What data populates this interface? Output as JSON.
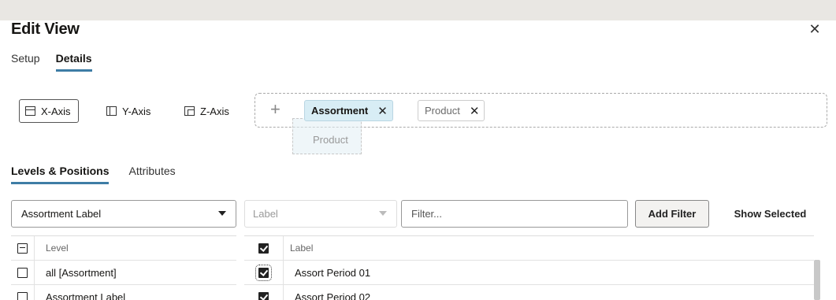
{
  "dialog": {
    "title": "Edit View",
    "close_icon": "close-icon",
    "tabs": [
      {
        "label": "Setup",
        "active": false
      },
      {
        "label": "Details",
        "active": true
      }
    ]
  },
  "axes": {
    "buttons": [
      {
        "label": "X-Axis",
        "icon": "x-axis-icon",
        "selected": true
      },
      {
        "label": "Y-Axis",
        "icon": "y-axis-icon",
        "selected": false
      },
      {
        "label": "Z-Axis",
        "icon": "z-axis-icon",
        "selected": false
      }
    ],
    "add_icon": "plus-icon",
    "chips": [
      {
        "label": "Assortment",
        "active": true,
        "remove_icon": "close-icon"
      },
      {
        "label": "Product",
        "active": false,
        "remove_icon": "close-icon"
      }
    ],
    "drag_ghost_label": "Product"
  },
  "subtabs": [
    {
      "label": "Levels & Positions",
      "active": true
    },
    {
      "label": "Attributes",
      "active": false
    }
  ],
  "toolbar": {
    "level_select": "Assortment Label",
    "label_select_placeholder": "Label",
    "filter_placeholder": "Filter...",
    "add_filter_label": "Add Filter",
    "show_selected_label": "Show Selected"
  },
  "levels_table": {
    "header": {
      "checkbox_state": "indeterminate",
      "column": "Level"
    },
    "rows": [
      {
        "checked": false,
        "value": "all [Assortment]"
      },
      {
        "checked": false,
        "value": "Assortment Label"
      }
    ]
  },
  "labels_table": {
    "header": {
      "checkbox_state": "checked",
      "column": "Label"
    },
    "rows": [
      {
        "checked": true,
        "value": "Assort Period 01"
      },
      {
        "checked": true,
        "value": "Assort Period 02"
      }
    ]
  },
  "colors": {
    "accent": "#3e7da5",
    "chip_active_bg": "#d8edf5"
  }
}
